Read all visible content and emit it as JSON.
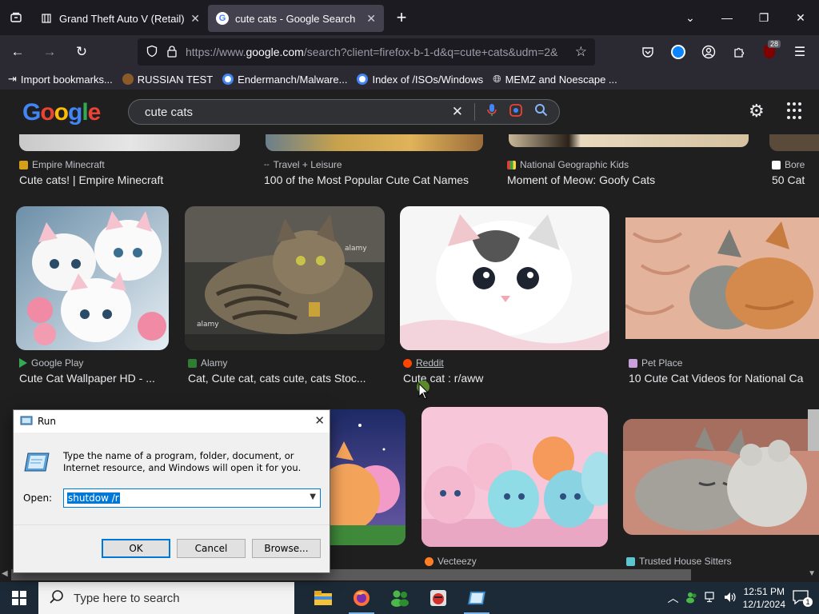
{
  "browser": {
    "tabs": [
      {
        "title": "Grand Theft Auto V (Retail) - PC",
        "active": false
      },
      {
        "title": "cute cats - Google Search",
        "active": true
      }
    ],
    "url_prefix": "https://www.",
    "url_domain": "google.com",
    "url_rest": "/search?client=firefox-b-1-d&q=cute+cats&udm=2&",
    "extension_badge": "28",
    "bookmarks": [
      {
        "label": "Import bookmarks..."
      },
      {
        "label": "RUSSIAN TEST"
      },
      {
        "label": "Endermanch/Malware..."
      },
      {
        "label": "Index of /ISOs/Windows"
      },
      {
        "label": "MEMZ and Noescape ..."
      }
    ]
  },
  "google": {
    "logo": "Google",
    "query": "cute cats",
    "top_row": [
      {
        "source": "Empire Minecraft",
        "title": "Cute cats! | Empire Minecraft"
      },
      {
        "source": "Travel + Leisure",
        "title": "100 of the Most Popular Cute Cat Names"
      },
      {
        "source": "National Geographic Kids",
        "title": "Moment of Meow: Goofy Cats"
      },
      {
        "source": "Bore",
        "title": "50 Cat"
      }
    ],
    "mid_row": [
      {
        "source": "Google Play",
        "title": "Cute Cat Wallpaper HD - ..."
      },
      {
        "source": "Alamy",
        "title": "Cat, Cute cat, cats cute, cats Stoc..."
      },
      {
        "source": "Reddit",
        "title": "Cute cat : r/aww"
      },
      {
        "source": "Pet Place",
        "title": "10 Cute Cat Videos for National Ca"
      }
    ],
    "bottom_row": [
      {
        "source": "Vecteezy"
      },
      {
        "source": "Trusted House Sitters"
      }
    ],
    "thumb_watermark": "alamy"
  },
  "run_dialog": {
    "title": "Run",
    "description": "Type the name of a program, folder, document, or Internet resource, and Windows will open it for you.",
    "open_label": "Open:",
    "open_value": "shutdow /r",
    "ok": "OK",
    "cancel": "Cancel",
    "browse": "Browse..."
  },
  "taskbar": {
    "search_placeholder": "Type here to search",
    "time": "12:51 PM",
    "date": "12/1/2024",
    "notification_count": "1"
  }
}
